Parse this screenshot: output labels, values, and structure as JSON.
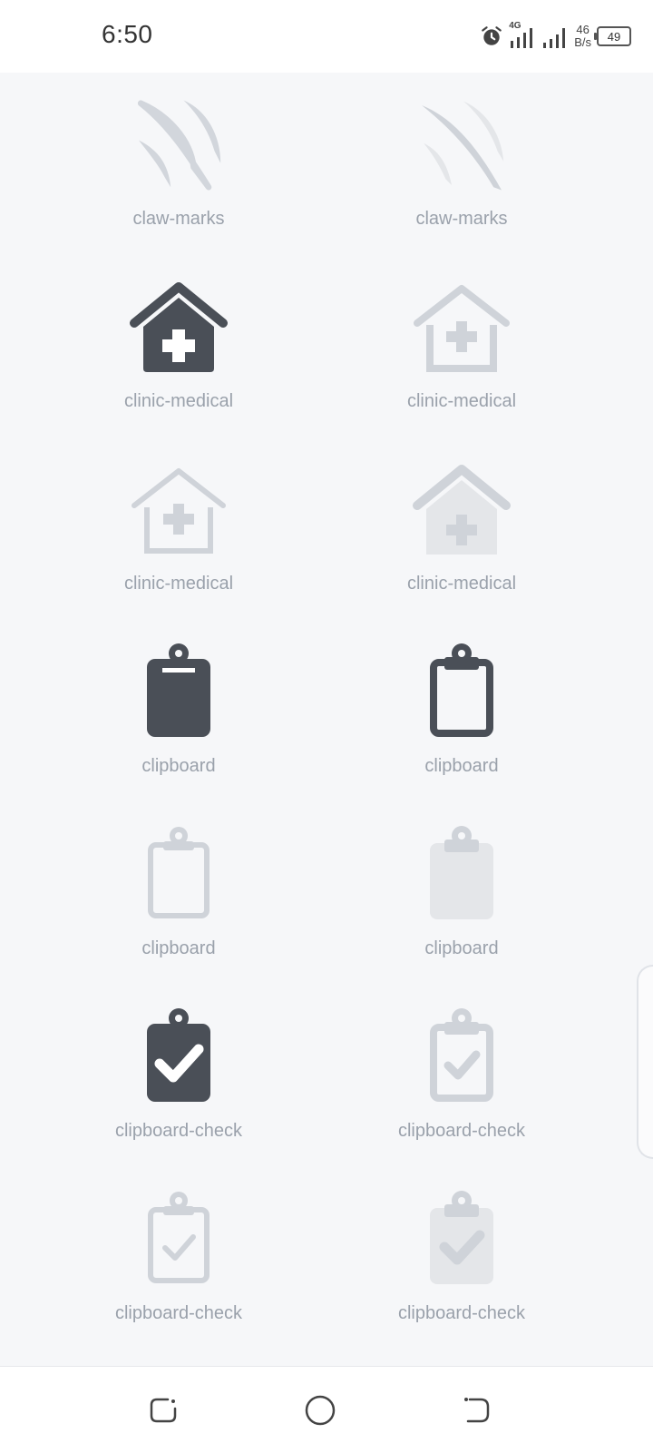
{
  "status_bar": {
    "time": "6:50",
    "network_type": "4G",
    "net_speed_value": "46",
    "net_speed_unit": "B/s",
    "battery": "49"
  },
  "icons": [
    {
      "label": "claw-marks",
      "icon": "claw-marks-icon"
    },
    {
      "label": "claw-marks",
      "icon": "claw-marks-icon"
    },
    {
      "label": "clinic-medical",
      "icon": "clinic-medical-icon"
    },
    {
      "label": "clinic-medical",
      "icon": "clinic-medical-icon"
    },
    {
      "label": "clinic-medical",
      "icon": "clinic-medical-icon"
    },
    {
      "label": "clinic-medical",
      "icon": "clinic-medical-icon"
    },
    {
      "label": "clipboard",
      "icon": "clipboard-icon"
    },
    {
      "label": "clipboard",
      "icon": "clipboard-icon"
    },
    {
      "label": "clipboard",
      "icon": "clipboard-icon"
    },
    {
      "label": "clipboard",
      "icon": "clipboard-icon"
    },
    {
      "label": "clipboard-check",
      "icon": "clipboard-check-icon"
    },
    {
      "label": "clipboard-check",
      "icon": "clipboard-check-icon"
    },
    {
      "label": "clipboard-check",
      "icon": "clipboard-check-icon"
    },
    {
      "label": "clipboard-check",
      "icon": "clipboard-check-icon"
    }
  ],
  "colors": {
    "solid": "#4a4f57",
    "light": "#cfd3d9",
    "lighter": "#e4e6e9",
    "label": "#9aa1ab",
    "background": "#f6f7f9"
  },
  "nav_bar": {
    "buttons": [
      "recents-icon",
      "home-icon",
      "back-icon"
    ]
  }
}
